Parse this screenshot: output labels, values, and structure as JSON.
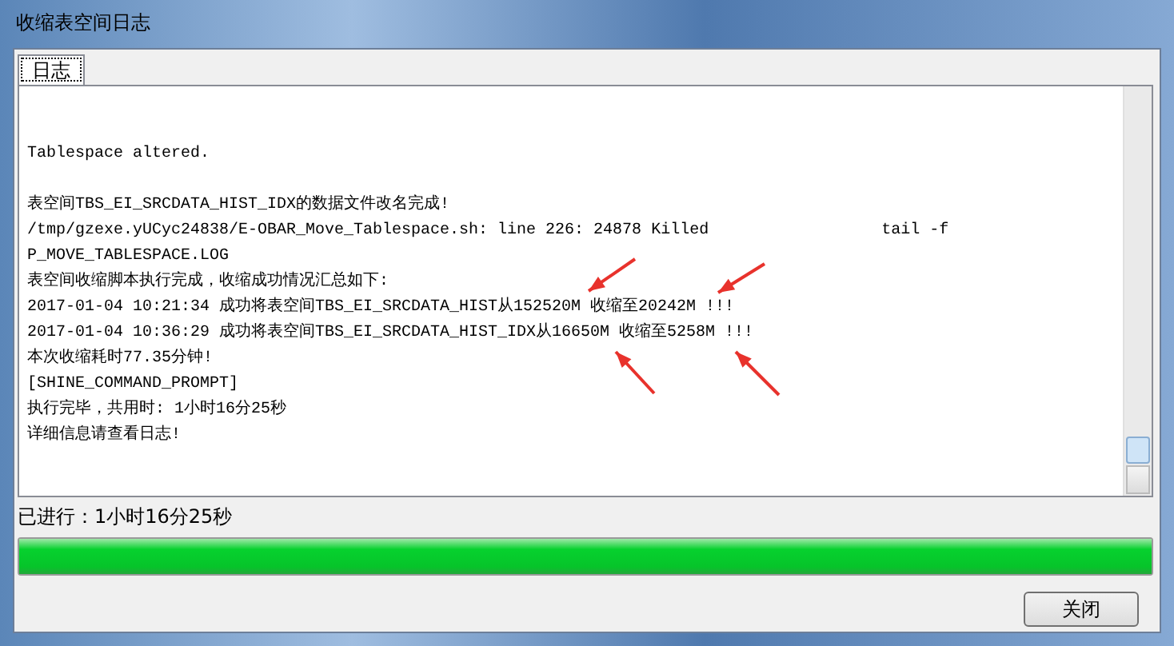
{
  "window": {
    "title": "收缩表空间日志"
  },
  "tabs": [
    {
      "label": "日志",
      "selected": true
    }
  ],
  "log_blocks": [
    [
      "Tablespace altered."
    ],
    [
      "表空间TBS_EI_SRCDATA_HIST_IDX的数据文件改名完成!",
      "/tmp/gzexe.yUCyc24838/E-OBAR_Move_Tablespace.sh: line 226: 24878 Killed                  tail -f",
      "P_MOVE_TABLESPACE.LOG",
      "表空间收缩脚本执行完成，收缩成功情况汇总如下:",
      "2017-01-04 10:21:34 成功将表空间TBS_EI_SRCDATA_HIST从152520M 收缩至20242M !!!",
      "2017-01-04 10:36:29 成功将表空间TBS_EI_SRCDATA_HIST_IDX从16650M 收缩至5258M !!!",
      "本次收缩耗时77.35分钟!",
      "[SHINE_COMMAND_PROMPT]",
      "执行完毕，共用时: 1小时16分25秒",
      "详细信息请查看日志!"
    ]
  ],
  "status": "已进行：1小时16分25秒",
  "progress": {
    "level": 1
  },
  "buttons": [
    "关闭"
  ]
}
